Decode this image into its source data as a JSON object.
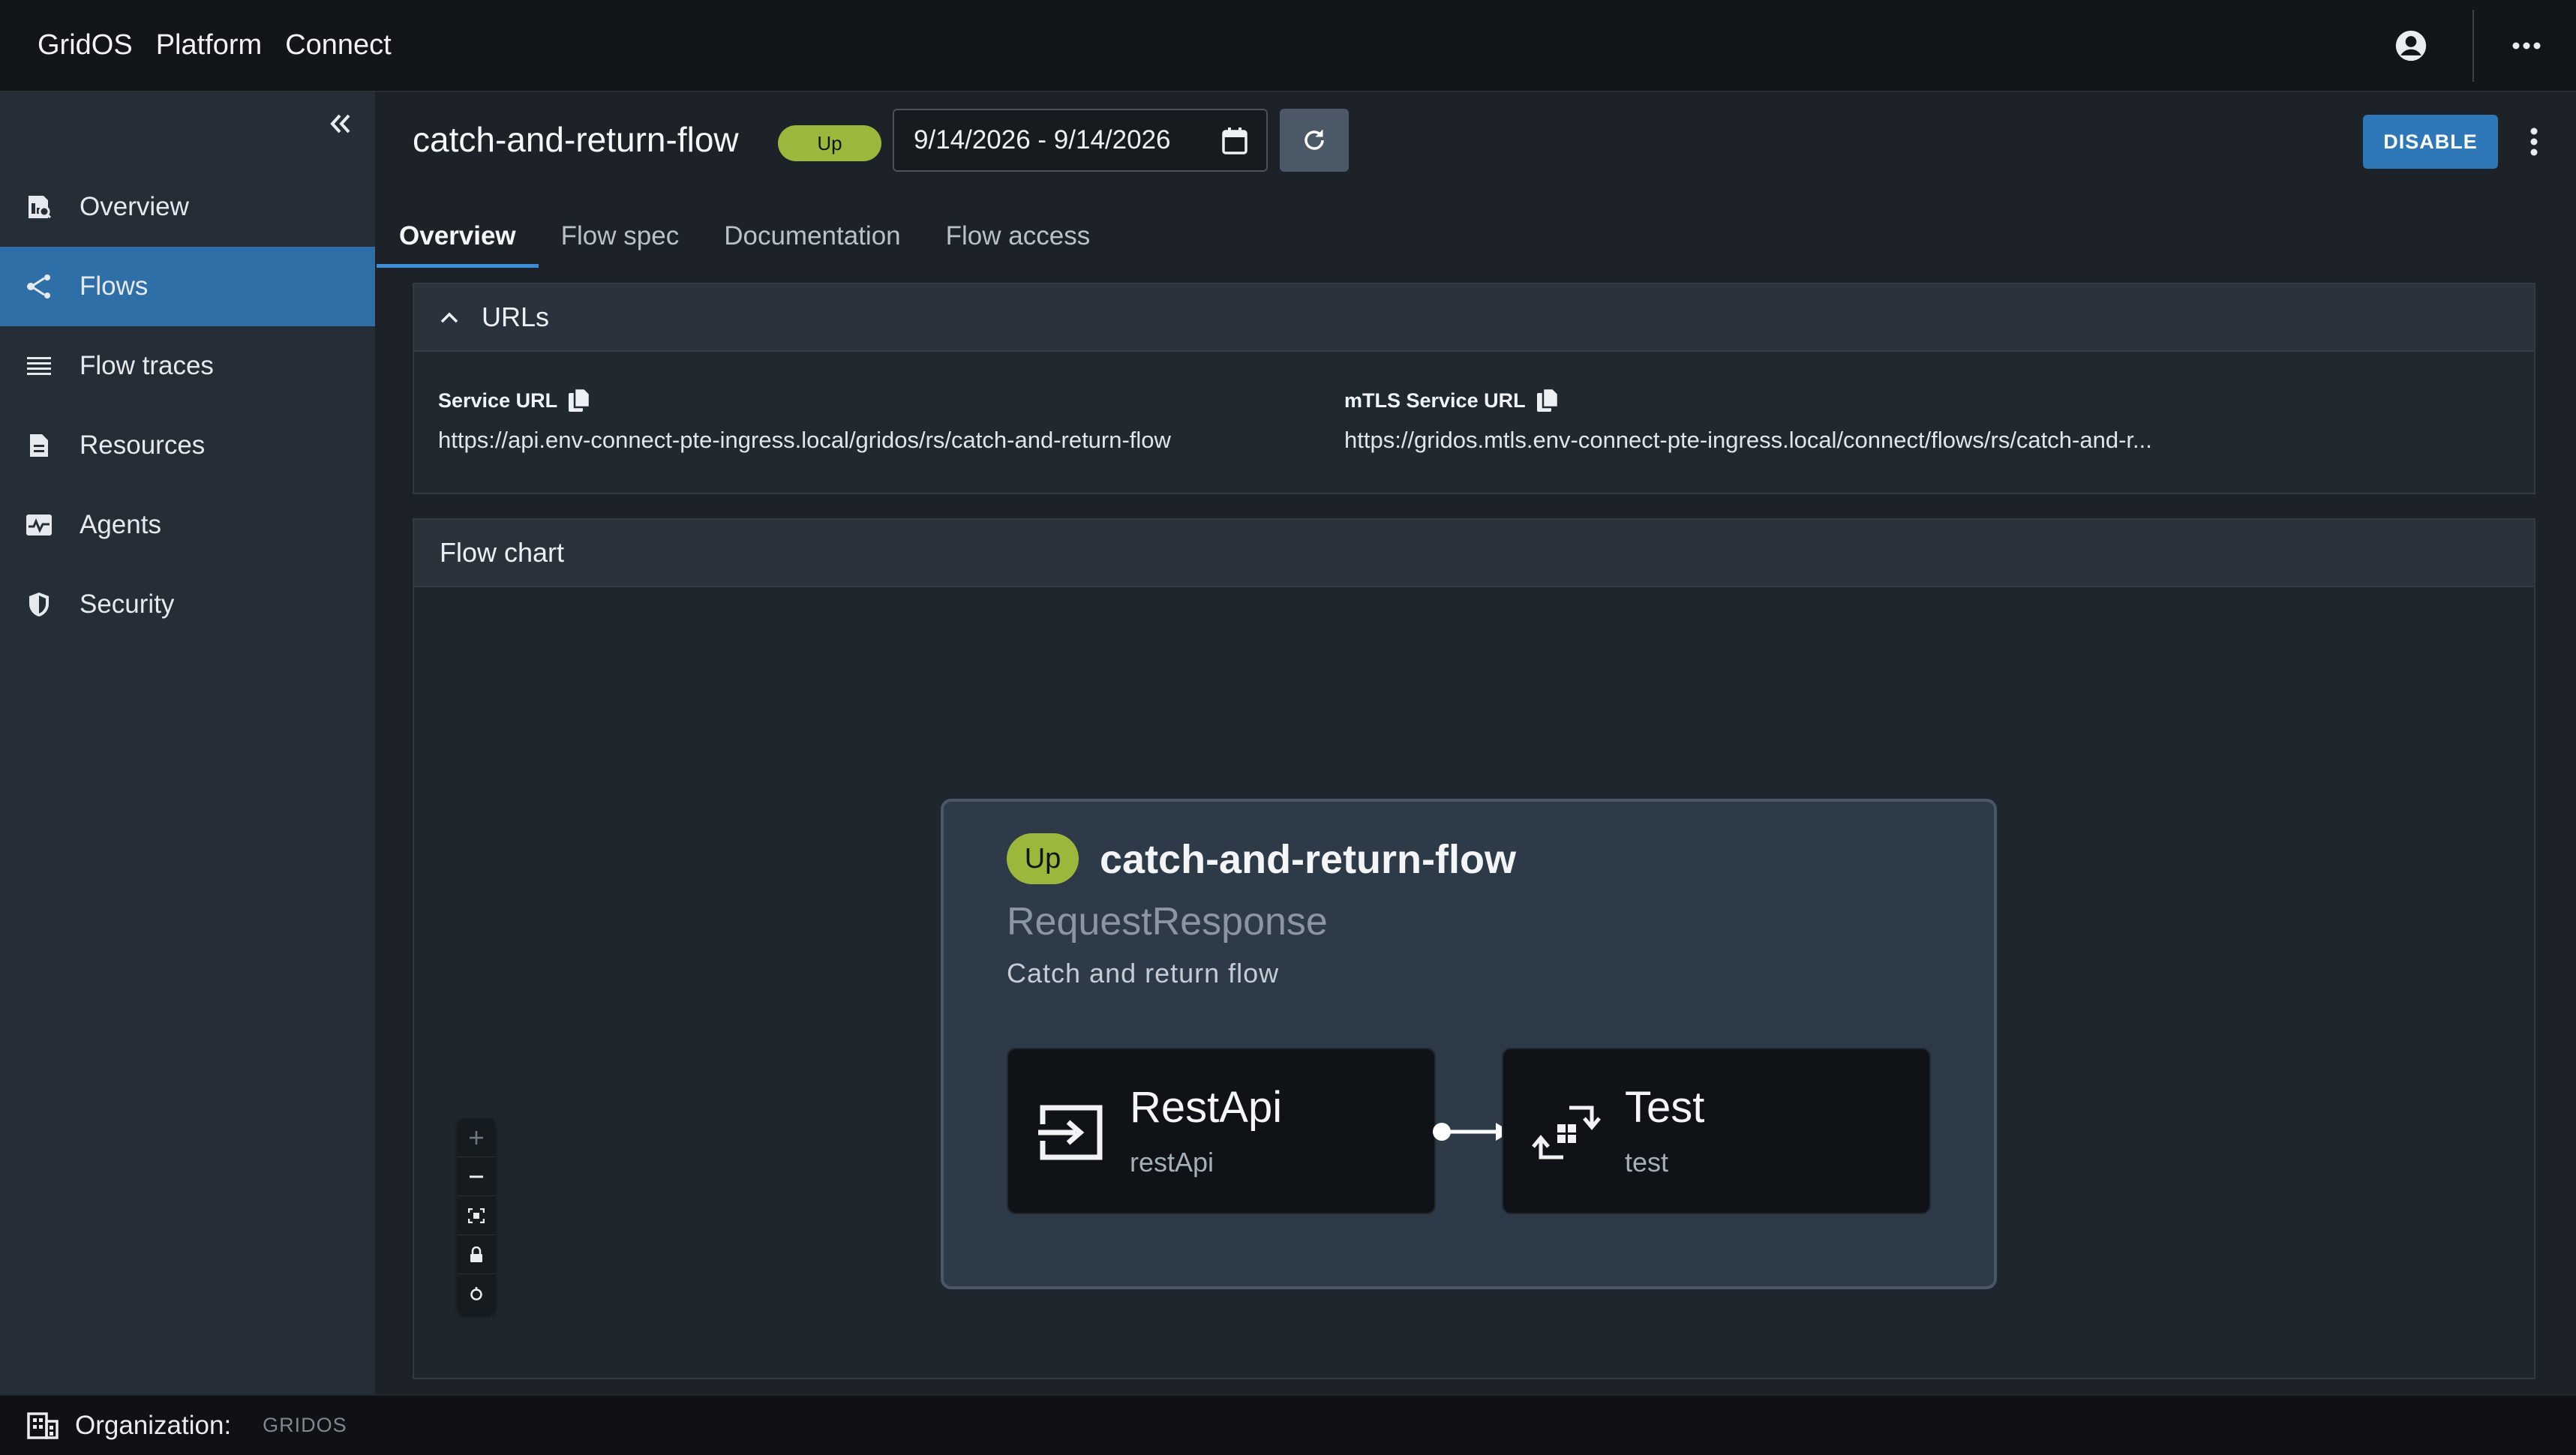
{
  "topbar": {
    "brand": [
      "GridOS",
      "Platform",
      "Connect"
    ]
  },
  "sidebar": {
    "items": [
      {
        "label": "Overview",
        "icon": "overview-icon"
      },
      {
        "label": "Flows",
        "icon": "flows-icon",
        "active": true
      },
      {
        "label": "Flow traces",
        "icon": "list-icon"
      },
      {
        "label": "Resources",
        "icon": "document-icon"
      },
      {
        "label": "Agents",
        "icon": "agents-icon"
      },
      {
        "label": "Security",
        "icon": "shield-icon"
      }
    ]
  },
  "org": {
    "label": "Organization:",
    "value": "GRIDOS"
  },
  "header": {
    "title": "catch-and-return-flow",
    "status": "Up",
    "date_range": "9/14/2026 - 9/14/2026",
    "disable_label": "DISABLE"
  },
  "tabs": [
    {
      "label": "Overview",
      "active": true
    },
    {
      "label": "Flow spec"
    },
    {
      "label": "Documentation"
    },
    {
      "label": "Flow access"
    }
  ],
  "urls": {
    "title": "URLs",
    "service_label": "Service URL",
    "service_value": "https://api.env-connect-pte-ingress.local/gridos/rs/catch-and-return-flow",
    "mtls_label": "mTLS Service URL",
    "mtls_value": "https://gridos.mtls.env-connect-pte-ingress.local/connect/flows/rs/catch-and-r..."
  },
  "flowchart": {
    "title": "Flow chart",
    "flow_status": "Up",
    "flow_name": "catch-and-return-flow",
    "flow_type": "RequestResponse",
    "flow_description": "Catch and return flow",
    "nodes": [
      {
        "name": "RestApi",
        "sub": "restApi",
        "icon": "input-icon"
      },
      {
        "name": "Test",
        "sub": "test",
        "icon": "transform-icon"
      }
    ]
  },
  "colors": {
    "accent": "#2f6fa8",
    "status_up": "#9bb83d",
    "disable_button": "#2e78b7",
    "tab_underline": "#3c8fd6"
  }
}
